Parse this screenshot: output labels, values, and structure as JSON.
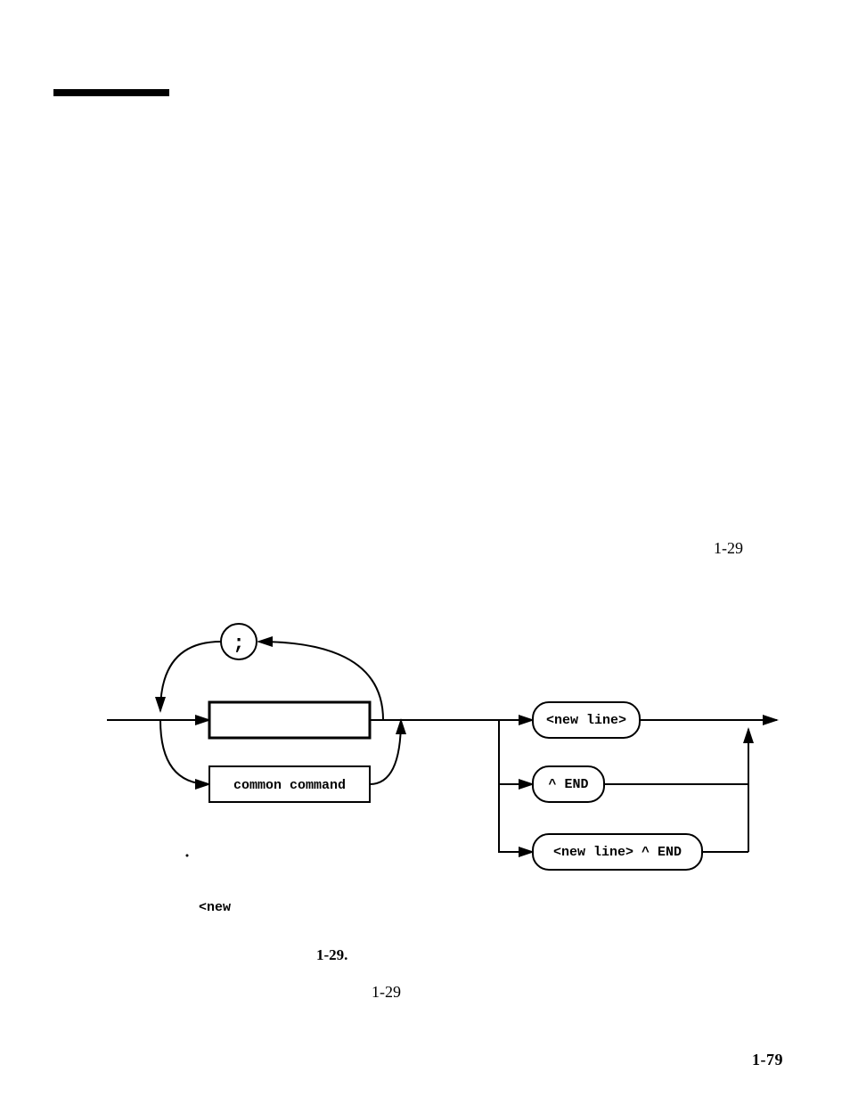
{
  "page_ref_right": "1-29",
  "figure_number": "1-29.",
  "figure_ref": "1-29",
  "page_number": "1-79",
  "stray_text": "<new",
  "diagram": {
    "semicolon": ";",
    "box_common": "common  command",
    "term_newline": "<new  line>",
    "term_end": "^ END",
    "term_newline_end": "<new  line> ^ END"
  },
  "chart_data": {
    "type": "diagram",
    "description": "Syntax railroad diagram for a program message",
    "nodes": [
      {
        "id": "semicolon",
        "label": ";",
        "shape": "round"
      },
      {
        "id": "instrument_cmd",
        "label": "",
        "shape": "rect"
      },
      {
        "id": "common_cmd",
        "label": "common command",
        "shape": "rect"
      },
      {
        "id": "newline",
        "label": "<new line>",
        "shape": "round"
      },
      {
        "id": "end",
        "label": "^END",
        "shape": "round"
      },
      {
        "id": "newline_end",
        "label": "<new line> ^END",
        "shape": "round"
      }
    ],
    "edges": [
      [
        "entry",
        "instrument_cmd"
      ],
      [
        "entry",
        "common_cmd"
      ],
      [
        "instrument_cmd",
        "semicolon"
      ],
      [
        "common_cmd",
        "instrument_cmd_merge"
      ],
      [
        "semicolon",
        "entry"
      ],
      [
        "merge",
        "newline"
      ],
      [
        "merge",
        "end"
      ],
      [
        "merge",
        "newline_end"
      ],
      [
        "newline",
        "exit"
      ],
      [
        "end",
        "exit"
      ],
      [
        "newline_end",
        "exit"
      ]
    ]
  }
}
